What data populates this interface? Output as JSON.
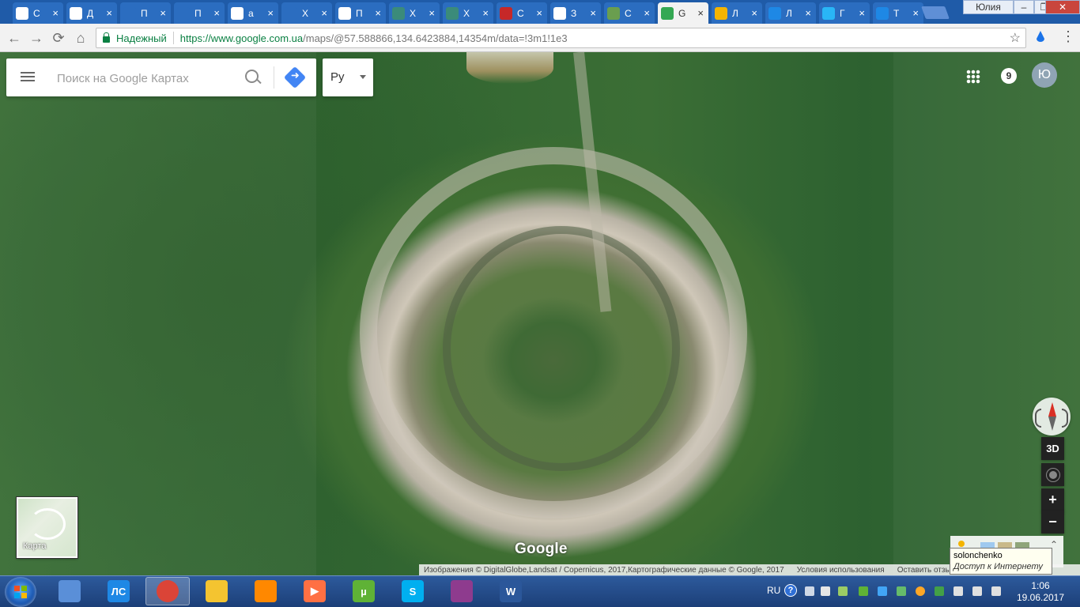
{
  "browser": {
    "tabs": [
      {
        "title": "С",
        "icon": "chrome-icon",
        "color": "#ffffff"
      },
      {
        "title": "Д",
        "icon": "wikipedia-icon",
        "color": "#ffffff"
      },
      {
        "title": "П",
        "icon": "page-icon",
        "color": "#2b6dc0"
      },
      {
        "title": "П",
        "icon": "page-icon",
        "color": "#2b6dc0"
      },
      {
        "title": "а",
        "icon": "google-icon",
        "color": "#ffffff"
      },
      {
        "title": "Х",
        "icon": "page-icon",
        "color": "#2b6dc0"
      },
      {
        "title": "П",
        "icon": "google-icon",
        "color": "#ffffff"
      },
      {
        "title": "Х",
        "icon": "odnoklassniki-icon",
        "color": "#3b8b7a"
      },
      {
        "title": "Х",
        "icon": "odnoklassniki-icon",
        "color": "#3b8b7a"
      },
      {
        "title": "С",
        "icon": "rr-icon",
        "color": "#c62828"
      },
      {
        "title": "З",
        "icon": "globe-icon",
        "color": "#ffffff"
      },
      {
        "title": "С",
        "icon": "landscape-icon",
        "color": "#6a9e4f"
      },
      {
        "title": "G",
        "icon": "google-maps-icon",
        "color": "#34a853",
        "active": true
      },
      {
        "title": "Л",
        "icon": "star-icon",
        "color": "#f4b400"
      },
      {
        "title": "Л",
        "icon": "diamond-icon",
        "color": "#1e88e5"
      },
      {
        "title": "Г",
        "icon": "wave-icon",
        "color": "#29b6f6"
      },
      {
        "title": "Т",
        "icon": "earth-icon",
        "color": "#1e88e5"
      }
    ],
    "close_glyph": "×",
    "window_user": "Юлия",
    "minimize_glyph": "–",
    "restore_glyph": "❐",
    "close_window_glyph": "✕",
    "secure_label": "Надежный",
    "url_host": "https://www.google.com.ua",
    "url_path": "/maps/@57.588866,134.6423884,14354m/data=!3m1!1e3",
    "star_glyph": "☆",
    "menu_glyph": "⋮",
    "back_glyph": "←",
    "forward_glyph": "→",
    "reload_glyph": "⟳",
    "home_glyph": "⌂"
  },
  "maps": {
    "search_placeholder": "Поиск на Google Картах",
    "language_value": "Ру",
    "notification_count": "9",
    "avatar_letter": "Ю",
    "control_3d": "3D",
    "zoom_in": "+",
    "zoom_out": "−",
    "minimap_label": "Карта",
    "logo": "Google",
    "attribution": "Изображения © DigitalGlobe,Landsat / Copernicus, 2017,Картографические данные © Google, 2017",
    "terms": "Условия использования",
    "feedback": "Оставить отзыв",
    "expand_glyph": "⌃",
    "tooltip": {
      "line1": "solonchenko",
      "line2": "Доступ к Интернету"
    }
  },
  "taskbar": {
    "apps": [
      {
        "name": "photo-viewer",
        "icon": "photo-icon",
        "color": "#5a8fd8",
        "label": ""
      },
      {
        "name": "lingvo",
        "icon": "lingvo-icon",
        "color": "#1e88e5",
        "label": "ЛС"
      },
      {
        "name": "chrome",
        "icon": "chrome-icon",
        "color": "#db4437",
        "label": "",
        "active": true
      },
      {
        "name": "explorer",
        "icon": "folder-icon",
        "color": "#f4c430",
        "label": ""
      },
      {
        "name": "vlc",
        "icon": "vlc-icon",
        "color": "#ff8800",
        "label": ""
      },
      {
        "name": "media-player",
        "icon": "media-icon",
        "color": "#ff7043",
        "label": "▶"
      },
      {
        "name": "utorrent",
        "icon": "utorrent-icon",
        "color": "#5fb236",
        "label": "µ"
      },
      {
        "name": "skype",
        "icon": "skype-icon",
        "color": "#00aff0",
        "label": "S"
      },
      {
        "name": "winrar",
        "icon": "winrar-icon",
        "color": "#8e3b8e",
        "label": ""
      },
      {
        "name": "word",
        "icon": "word-icon",
        "color": "#2b579a",
        "label": "W"
      }
    ],
    "language": "RU",
    "help_glyph": "?",
    "time": "1:06",
    "date": "19.06.2017"
  }
}
